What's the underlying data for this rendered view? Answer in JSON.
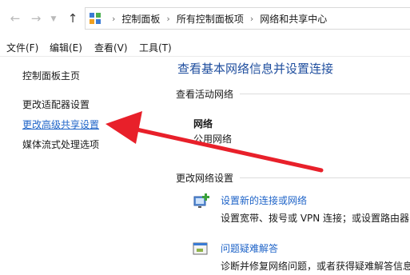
{
  "address_bar": {
    "breadcrumbs": [
      "控制面板",
      "所有控制面板项",
      "网络和共享中心"
    ]
  },
  "menu": {
    "items": [
      "文件(F)",
      "编辑(E)",
      "查看(V)",
      "工具(T)"
    ]
  },
  "sidebar": {
    "home": "控制面板主页",
    "items": [
      {
        "label": "更改适配器设置"
      },
      {
        "label": "更改高级共享设置"
      },
      {
        "label": "媒体流式处理选项"
      }
    ]
  },
  "main": {
    "title": "查看基本网络信息并设置连接",
    "active_networks_header": "查看活动网络",
    "network": {
      "name": "网络",
      "type": "公用网络"
    },
    "change_settings_header": "更改网络设置",
    "tasks": [
      {
        "link": "设置新的连接或网络",
        "desc": "设置宽带、拨号或 VPN 连接；或设置路由器"
      },
      {
        "link": "问题疑难解答",
        "desc": "诊断并修复网络问题，或者获得疑难解答信息"
      }
    ]
  },
  "colors": {
    "link": "#1f64c8",
    "title": "#1f4e9e",
    "annotation_arrow": "#e8202a"
  }
}
